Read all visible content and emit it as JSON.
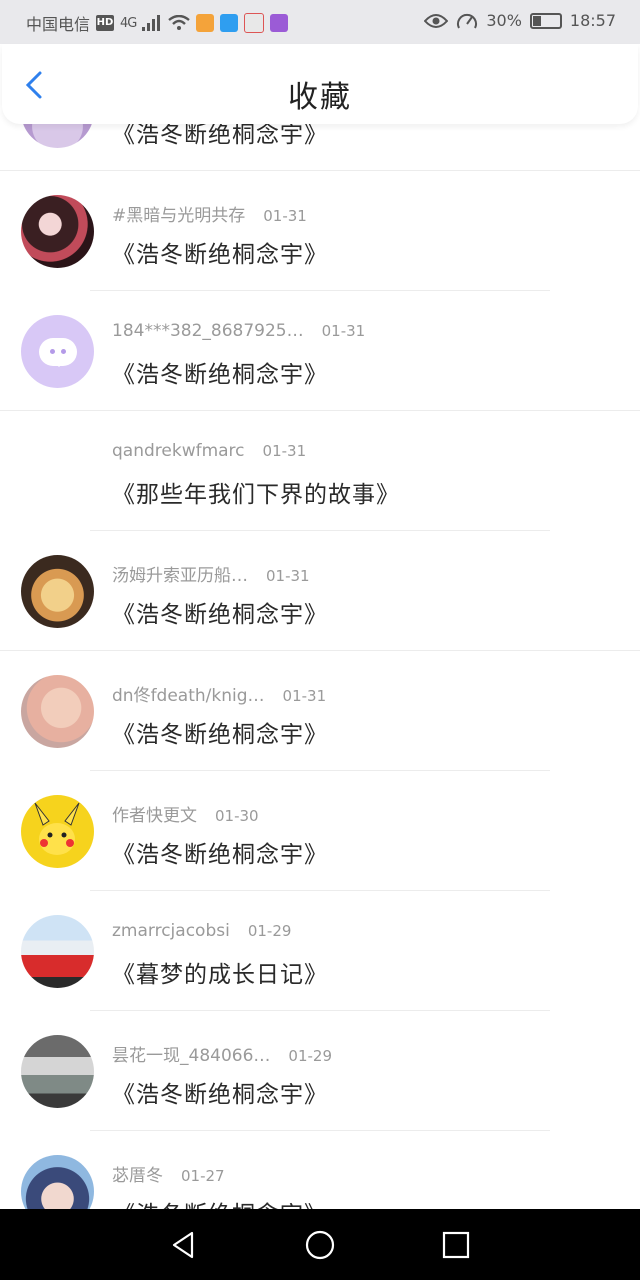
{
  "status_bar": {
    "carrier": "中国电信",
    "hd": "HD",
    "network": "4G",
    "battery_percent": "30%",
    "time": "18:57"
  },
  "header": {
    "title": "收藏"
  },
  "items": [
    {
      "author": "",
      "date": "",
      "title": "《浩冬断绝桐念宇》"
    },
    {
      "author": "#黑暗与光明共存",
      "date": "01-31",
      "title": "《浩冬断绝桐念宇》"
    },
    {
      "author": "184***382_8687925…",
      "date": "01-31",
      "title": "《浩冬断绝桐念宇》"
    },
    {
      "author": "qandrekwfmarc",
      "date": "01-31",
      "title": "《那些年我们下界的故事》"
    },
    {
      "author": "汤姆升索亚历船…",
      "date": "01-31",
      "title": "《浩冬断绝桐念宇》"
    },
    {
      "author": "dn佟fdeath/knig…",
      "date": "01-31",
      "title": "《浩冬断绝桐念宇》"
    },
    {
      "author": "作者快更文",
      "date": "01-30",
      "title": "《浩冬断绝桐念宇》"
    },
    {
      "author": "zmarrcjacobsi",
      "date": "01-29",
      "title": "《暮梦的成长日记》"
    },
    {
      "author": "昙花一现_484066…",
      "date": "01-29",
      "title": "《浩冬断绝桐念宇》"
    },
    {
      "author": "苾厝冬",
      "date": "01-27",
      "title": "《浩冬断绝桐念宇》"
    }
  ],
  "nav": {
    "back_icon": "triangle-back-icon",
    "home_icon": "circle-home-icon",
    "recents_icon": "square-recents-icon"
  },
  "colors": {
    "accent": "#2f80ed",
    "status_bg": "#e9e9ec"
  }
}
